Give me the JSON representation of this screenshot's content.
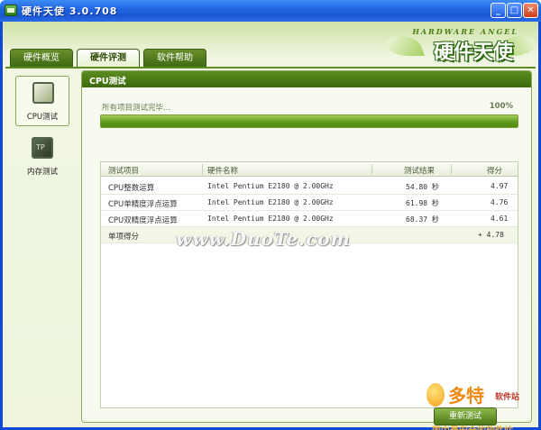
{
  "window": {
    "title": "硬件天使  3.0.708",
    "buttons": {
      "minimize": "_",
      "maximize": "□",
      "close": "✕"
    }
  },
  "logo": {
    "top": "HARDWARE ANGEL",
    "main": "硬件天使"
  },
  "tabs": [
    {
      "label": "硬件概览",
      "active": false
    },
    {
      "label": "硬件评测",
      "active": true
    },
    {
      "label": "软件帮助",
      "active": false
    }
  ],
  "sidebar": {
    "items": [
      {
        "label": "CPU测试",
        "icon": "monitor-icon",
        "active": true
      },
      {
        "label": "内存测试",
        "icon": "memory-chip-icon",
        "active": false
      }
    ]
  },
  "panel": {
    "title": "CPU测试",
    "progress": {
      "text": "所有项目测试完毕...",
      "percent_label": "100%",
      "value": 1.0
    }
  },
  "table": {
    "headers": [
      "测试项目",
      "硬件名称",
      "测试结果",
      "得分"
    ],
    "rows": [
      {
        "item": "CPU整数运算",
        "hardware": "Intel Pentium E2180 @ 2.00GHz",
        "result": "54.80 秒",
        "score": "4.97"
      },
      {
        "item": "CPU单精度浮点运算",
        "hardware": "Intel Pentium E2180 @ 2.00GHz",
        "result": "61.98 秒",
        "score": "4.76"
      },
      {
        "item": "CPU双精度浮点运算",
        "hardware": "Intel Pentium E2180 @ 2.00GHz",
        "result": "68.37 秒",
        "score": "4.61"
      }
    ],
    "summary": {
      "label": "单项得分",
      "score": "+ 4.78"
    }
  },
  "watermark": "www.DuoTe.com",
  "rerun_button": "重新测试",
  "site": {
    "name": "多特",
    "sub": "软件站",
    "slogan": "国内最安全的软件站"
  },
  "colors": {
    "accent": "#5b8c1f",
    "titlebar": "#1f62e0",
    "site": "#f08a12"
  }
}
